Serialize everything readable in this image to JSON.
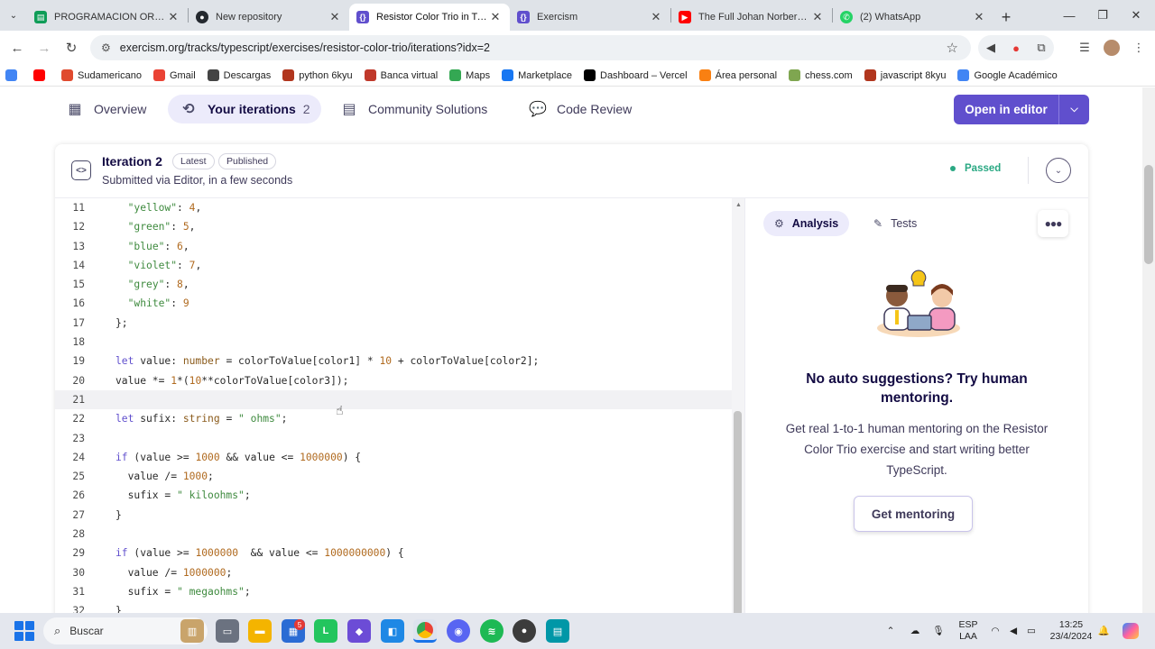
{
  "browser": {
    "tabs": [
      {
        "title": "PROGRAMACION ORIENT",
        "icon": "sheets-icon",
        "color": "#0f9d58",
        "active": false
      },
      {
        "title": "New repository",
        "icon": "github-icon",
        "color": "#24292f",
        "active": false
      },
      {
        "title": "Resistor Color Trio in TypeS",
        "icon": "exercism-icon",
        "color": "#604fcd",
        "active": true
      },
      {
        "title": "Exercism",
        "icon": "exercism-icon",
        "color": "#604fcd",
        "active": false
      },
      {
        "title": "The Full Johan Norberg: S",
        "icon": "youtube-icon",
        "color": "#ff0000",
        "active": false
      },
      {
        "title": "(2) WhatsApp",
        "icon": "whatsapp-icon",
        "color": "#25d366",
        "active": false
      }
    ],
    "url": "exercism.org/tracks/typescript/exercises/resistor-color-trio/iterations?idx=2",
    "bookmarks": [
      {
        "label": "",
        "icon": "translate-icon",
        "color": "#4285f4"
      },
      {
        "label": "",
        "icon": "youtube-icon",
        "color": "#ff0000"
      },
      {
        "label": "Sudamericano",
        "icon": "sudamericano-icon",
        "color": "#e04a2f"
      },
      {
        "label": "Gmail",
        "icon": "gmail-icon",
        "color": "#ea4335"
      },
      {
        "label": "Descargas",
        "icon": "download-icon",
        "color": "#444444"
      },
      {
        "label": "python 6kyu",
        "icon": "codewars-icon",
        "color": "#b1361e"
      },
      {
        "label": "Banca virtual",
        "icon": "bank-icon",
        "color": "#c0392b"
      },
      {
        "label": "Maps",
        "icon": "maps-icon",
        "color": "#34a853"
      },
      {
        "label": "Marketplace",
        "icon": "facebook-icon",
        "color": "#1877f2"
      },
      {
        "label": "Dashboard – Vercel",
        "icon": "vercel-icon",
        "color": "#000000"
      },
      {
        "label": "Área personal",
        "icon": "moodle-icon",
        "color": "#f98012"
      },
      {
        "label": "chess.com",
        "icon": "chess-icon",
        "color": "#7fa650"
      },
      {
        "label": "javascript 8kyu",
        "icon": "codewars-icon",
        "color": "#b1361e"
      },
      {
        "label": "Google Académico",
        "icon": "scholar-icon",
        "color": "#4285f4"
      }
    ]
  },
  "exercise_nav": {
    "overview": "Overview",
    "iterations": "Your iterations",
    "iterations_count": "2",
    "community": "Community Solutions",
    "review": "Code Review",
    "open_editor": "Open in editor"
  },
  "iteration": {
    "title": "Iteration 2",
    "badge_latest": "Latest",
    "badge_published": "Published",
    "subtitle": "Submitted via Editor, in a few seconds",
    "status": "Passed",
    "status_color": "#2aa883"
  },
  "code_lines": [
    {
      "n": "11",
      "text": "  \"yellow\": 4,"
    },
    {
      "n": "12",
      "text": "  \"green\": 5,"
    },
    {
      "n": "13",
      "text": "  \"blue\": 6,"
    },
    {
      "n": "14",
      "text": "  \"violet\": 7,"
    },
    {
      "n": "15",
      "text": "  \"grey\": 8,"
    },
    {
      "n": "16",
      "text": "  \"white\": 9"
    },
    {
      "n": "17",
      "text": "};"
    },
    {
      "n": "18",
      "text": ""
    },
    {
      "n": "19",
      "text": "let value: number = colorToValue[color1] * 10 + colorToValue[color2];"
    },
    {
      "n": "20",
      "text": "value *= 1*(10**colorToValue[color3]);"
    },
    {
      "n": "21",
      "text": ""
    },
    {
      "n": "22",
      "text": "let sufix: string = \" ohms\";"
    },
    {
      "n": "23",
      "text": ""
    },
    {
      "n": "24",
      "text": "if (value >= 1000 && value <= 1000000) {"
    },
    {
      "n": "25",
      "text": "  value /= 1000;"
    },
    {
      "n": "26",
      "text": "  sufix = \" kiloohms\";"
    },
    {
      "n": "27",
      "text": "}"
    },
    {
      "n": "28",
      "text": ""
    },
    {
      "n": "29",
      "text": "if (value >= 1000000  && value <= 1000000000) {"
    },
    {
      "n": "30",
      "text": "  value /= 1000000;"
    },
    {
      "n": "31",
      "text": "  sufix = \" megaohms\";"
    },
    {
      "n": "32",
      "text": "}"
    }
  ],
  "highlighted_line": "21",
  "panel": {
    "tab_analysis": "Analysis",
    "tab_tests": "Tests",
    "mentor_title": "No auto suggestions? Try human mentoring.",
    "mentor_desc": "Get real 1-to-1 human mentoring on the Resistor Color Trio exercise and start writing better TypeScript.",
    "cta": "Get mentoring"
  },
  "taskbar": {
    "search_placeholder": "Buscar",
    "lang_top": "ESP",
    "lang_bottom": "LAA",
    "time": "13:25",
    "date": "23/4/2024",
    "badge_count": "5"
  }
}
